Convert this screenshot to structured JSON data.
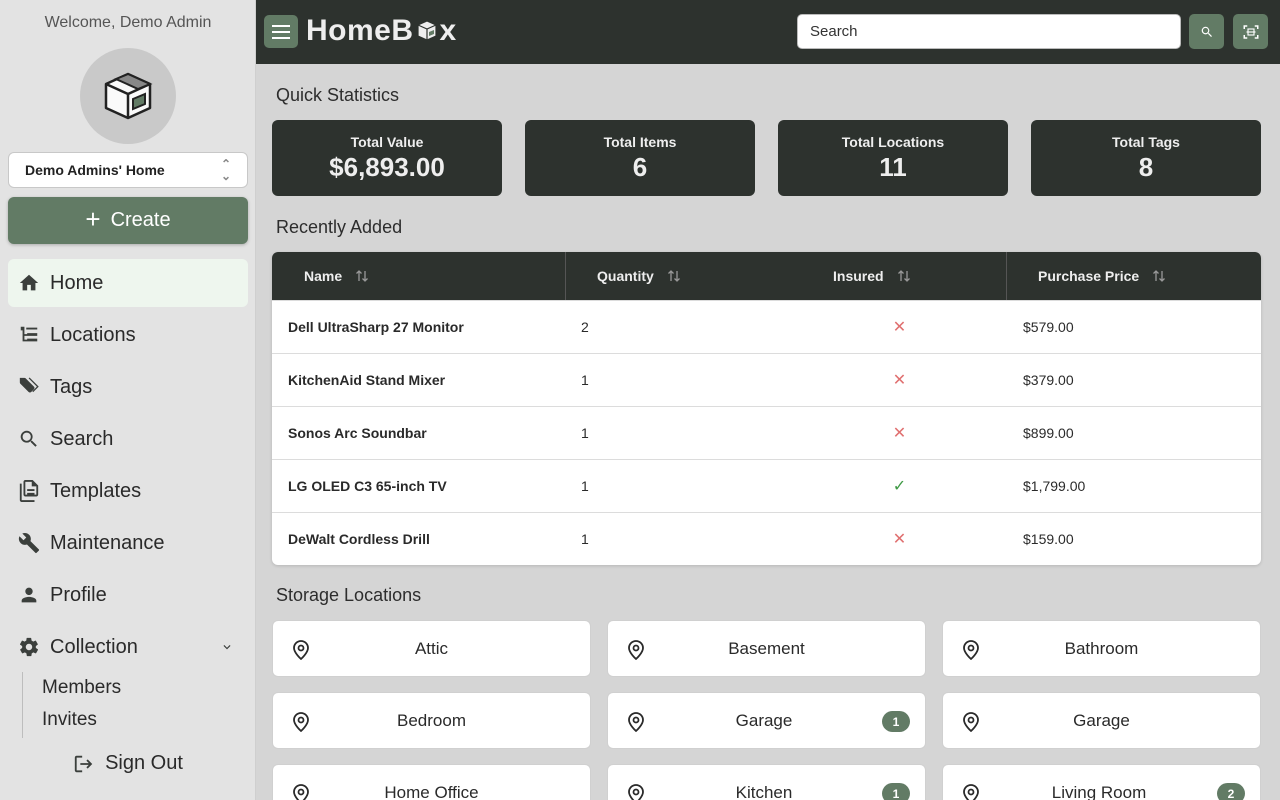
{
  "sidebar": {
    "welcome": "Welcome, Demo Admin",
    "home_select": "Demo Admins' Home",
    "create_label": "Create",
    "nav": [
      "Home",
      "Locations",
      "Tags",
      "Search",
      "Templates",
      "Maintenance",
      "Profile",
      "Collection"
    ],
    "collection_sub": [
      "Members",
      "Invites"
    ],
    "signout": "Sign Out"
  },
  "topbar": {
    "logo_left": "HomeB",
    "logo_right": "x",
    "search_placeholder": "Search"
  },
  "sections": {
    "quick_stats": "Quick Statistics",
    "recent": "Recently Added",
    "storage": "Storage Locations"
  },
  "stats": [
    {
      "label": "Total Value",
      "value": "$6,893.00"
    },
    {
      "label": "Total Items",
      "value": "6"
    },
    {
      "label": "Total Locations",
      "value": "11"
    },
    {
      "label": "Total Tags",
      "value": "8"
    }
  ],
  "table": {
    "headers": [
      "Name",
      "Quantity",
      "Insured",
      "Purchase Price"
    ],
    "rows": [
      {
        "name": "Dell UltraSharp 27 Monitor",
        "qty": "2",
        "insured": false,
        "price": "$579.00"
      },
      {
        "name": "KitchenAid Stand Mixer",
        "qty": "1",
        "insured": false,
        "price": "$379.00"
      },
      {
        "name": "Sonos Arc Soundbar",
        "qty": "1",
        "insured": false,
        "price": "$899.00"
      },
      {
        "name": "LG OLED C3 65-inch TV",
        "qty": "1",
        "insured": true,
        "price": "$1,799.00"
      },
      {
        "name": "DeWalt Cordless Drill",
        "qty": "1",
        "insured": false,
        "price": "$159.00"
      }
    ],
    "insured_yes_glyph": "✓",
    "insured_no_glyph": "✕"
  },
  "locations": [
    {
      "name": "Attic",
      "count": ""
    },
    {
      "name": "Basement",
      "count": ""
    },
    {
      "name": "Bathroom",
      "count": ""
    },
    {
      "name": "Bedroom",
      "count": ""
    },
    {
      "name": "Garage",
      "count": "1"
    },
    {
      "name": "Garage",
      "count": ""
    },
    {
      "name": "Home Office",
      "count": ""
    },
    {
      "name": "Kitchen",
      "count": "1"
    },
    {
      "name": "Living Room",
      "count": "2"
    }
  ],
  "colors": {
    "accent": "#627b65",
    "dark": "#2d322e",
    "danger": "#e07070",
    "success": "#3f9a45"
  }
}
